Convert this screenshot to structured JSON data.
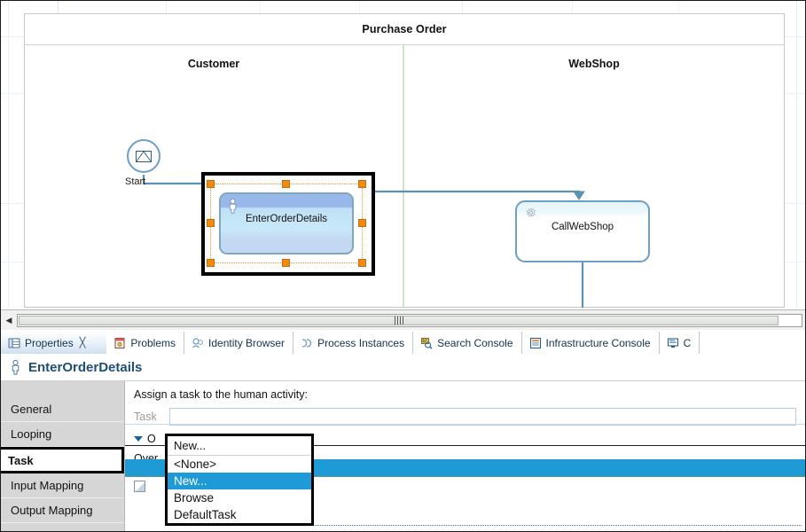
{
  "diagram": {
    "pool_title": "Purchase Order",
    "lanes": [
      {
        "title": "Customer"
      },
      {
        "title": "WebShop"
      }
    ],
    "nodes": [
      {
        "id": "start",
        "label": "Start",
        "type": "message-start-event"
      },
      {
        "id": "human",
        "label": "EnterOrderDetails",
        "type": "user-task",
        "selected": true
      },
      {
        "id": "service",
        "label": "CallWebShop",
        "type": "service-task"
      }
    ],
    "scrollbar": {
      "left_arrow": "◀"
    }
  },
  "tabs": [
    {
      "label": "Properties",
      "icon": "properties-icon",
      "active": true,
      "close": "╳"
    },
    {
      "label": "Problems",
      "icon": "problems-icon",
      "active": false
    },
    {
      "label": "Identity Browser",
      "icon": "identity-browser-icon",
      "active": false
    },
    {
      "label": "Process Instances",
      "icon": "process-instances-icon",
      "active": false
    },
    {
      "label": "Search Console",
      "icon": "search-console-icon",
      "active": false
    },
    {
      "label": "Infrastructure Console",
      "icon": "infrastructure-console-icon",
      "active": false
    },
    {
      "label": "C",
      "icon": "console-icon",
      "active": false
    }
  ],
  "properties": {
    "title": "EnterOrderDetails",
    "title_icon": "user-task-icon",
    "nav": [
      {
        "label": "General",
        "selected": false
      },
      {
        "label": "Looping",
        "selected": false
      },
      {
        "label": "Task",
        "selected": true
      },
      {
        "label": "Input Mapping",
        "selected": false
      },
      {
        "label": "Output Mapping",
        "selected": false
      }
    ],
    "assign_label": "Assign a task to the human activity:",
    "task_field_label": "Task",
    "section_label": "O",
    "overview_label": "Over"
  },
  "dropdown": {
    "selected_value": "New...",
    "options": [
      {
        "label": "<None>",
        "highlighted": false
      },
      {
        "label": "New...",
        "highlighted": true
      },
      {
        "label": "Browse",
        "highlighted": false
      },
      {
        "label": "DefaultTask",
        "highlighted": false
      }
    ]
  },
  "colors": {
    "selection_blue": "#1e9ad6",
    "handle_orange": "#f08a12",
    "title_blue": "#1f4e79",
    "lane_border_green": "#cfe4cf"
  }
}
